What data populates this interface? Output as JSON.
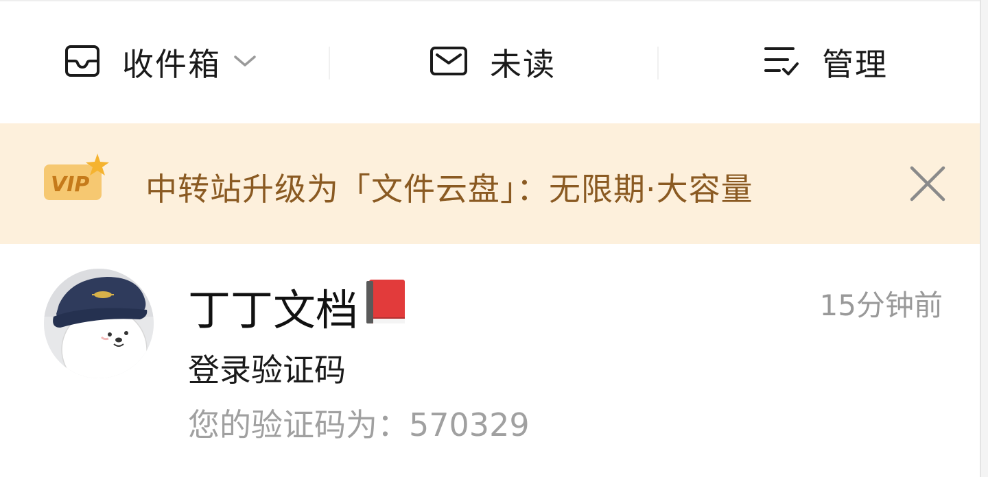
{
  "toolbar": {
    "inbox_label": "收件箱",
    "unread_label": "未读",
    "manage_label": "管理"
  },
  "banner": {
    "vip_badge_text": "VIP",
    "text": "中转站升级为「文件云盘」：无限期·大容量"
  },
  "messages": [
    {
      "sender": "丁丁文档",
      "time": "15分钟前",
      "subject": "登录验证码",
      "preview": "您的验证码为：570329"
    }
  ],
  "colors": {
    "banner_bg": "#fdf0dc",
    "banner_text": "#8a5a22",
    "vip_badge": "#f6c871",
    "muted_text": "#a0a0a0"
  },
  "icons": {
    "inbox": "inbox-tray-icon",
    "unread": "envelope-icon",
    "manage": "list-check-icon",
    "dropdown": "chevron-down-icon",
    "close": "close-icon",
    "book": "red-book-icon"
  }
}
